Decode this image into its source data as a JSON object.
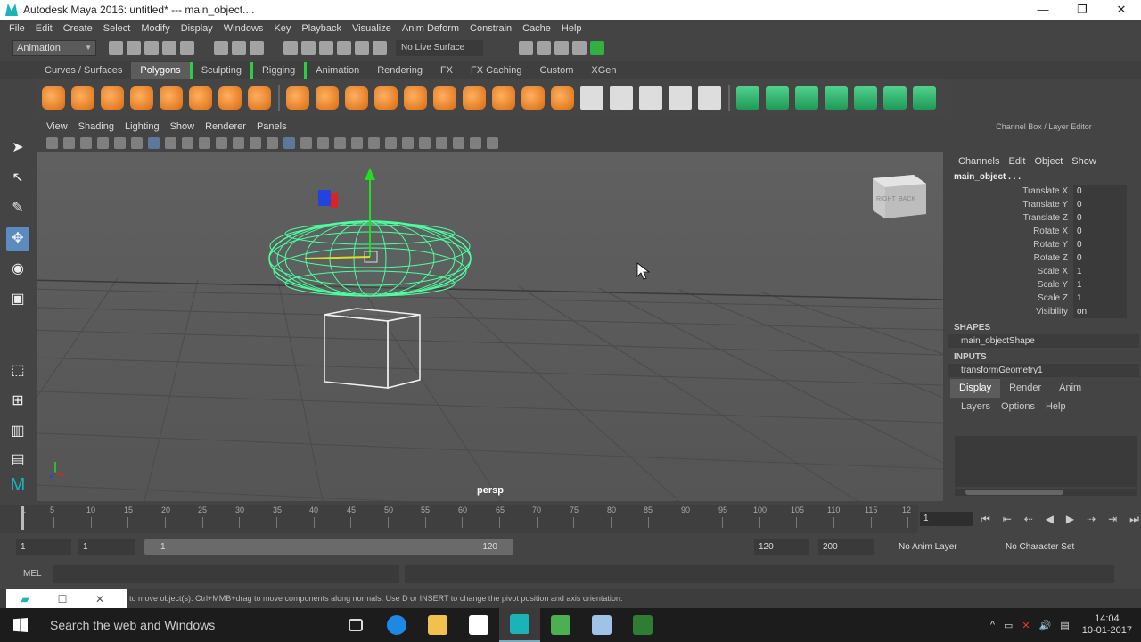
{
  "window": {
    "title": "Autodesk Maya 2016: untitled*   ---   main_object....",
    "minimize": "—",
    "maximize": "❐",
    "close": "✕"
  },
  "menubar": [
    "File",
    "Edit",
    "Create",
    "Select",
    "Modify",
    "Display",
    "Windows",
    "Key",
    "Playback",
    "Visualize",
    "Anim Deform",
    "Constrain",
    "Cache",
    "Help"
  ],
  "statusline": {
    "mode": "Animation",
    "live_surface": "No Live Surface"
  },
  "shelf_tabs": [
    "Curves / Surfaces",
    "Polygons",
    "Sculpting",
    "Rigging",
    "Animation",
    "Rendering",
    "FX",
    "FX Caching",
    "Custom",
    "XGen"
  ],
  "viewport": {
    "menu": [
      "View",
      "Shading",
      "Lighting",
      "Show",
      "Renderer",
      "Panels"
    ],
    "camera_label": "persp",
    "viewcube_labels": [
      "RIGHT",
      "BACK"
    ]
  },
  "channel_box": {
    "title": "Channel Box / Layer Editor",
    "menu": [
      "Channels",
      "Edit",
      "Object",
      "Show"
    ],
    "object": "main_object . . .",
    "channels": [
      {
        "label": "Translate X",
        "value": "0"
      },
      {
        "label": "Translate Y",
        "value": "0"
      },
      {
        "label": "Translate Z",
        "value": "0"
      },
      {
        "label": "Rotate X",
        "value": "0"
      },
      {
        "label": "Rotate Y",
        "value": "0"
      },
      {
        "label": "Rotate Z",
        "value": "0"
      },
      {
        "label": "Scale X",
        "value": "1"
      },
      {
        "label": "Scale Y",
        "value": "1"
      },
      {
        "label": "Scale Z",
        "value": "1"
      },
      {
        "label": "Visibility",
        "value": "on"
      }
    ],
    "shapes_header": "SHAPES",
    "shape": "main_objectShape",
    "inputs_header": "INPUTS",
    "input": "transformGeometry1"
  },
  "layer_editor": {
    "tabs": [
      "Display",
      "Render",
      "Anim"
    ],
    "menu": [
      "Layers",
      "Options",
      "Help"
    ]
  },
  "timeline": {
    "ticks": [
      "1",
      "5",
      "10",
      "15",
      "20",
      "25",
      "30",
      "35",
      "40",
      "45",
      "50",
      "55",
      "60",
      "65",
      "70",
      "75",
      "80",
      "85",
      "90",
      "95",
      "100",
      "105",
      "110",
      "115",
      "12"
    ],
    "current_frame": "1"
  },
  "range": {
    "start": "1",
    "playback_start": "1",
    "slider_start": "1",
    "slider_end": "120",
    "playback_end": "120",
    "end": "200",
    "anim_layer": "No Anim Layer",
    "character_set": "No Character Set"
  },
  "commandline": {
    "label": "MEL"
  },
  "helpline": {
    "text": "to move object(s). Ctrl+MMB+drag to move components along normals. Use D or INSERT to change the pivot position and axis orientation."
  },
  "taskbar": {
    "search": "Search the web and Windows",
    "time": "14:04",
    "date": "10-01-2017"
  },
  "colors": {
    "accent": "#2ecc40",
    "selected_wire": "#4dffa0",
    "tool_active": "#5b8bbf"
  }
}
